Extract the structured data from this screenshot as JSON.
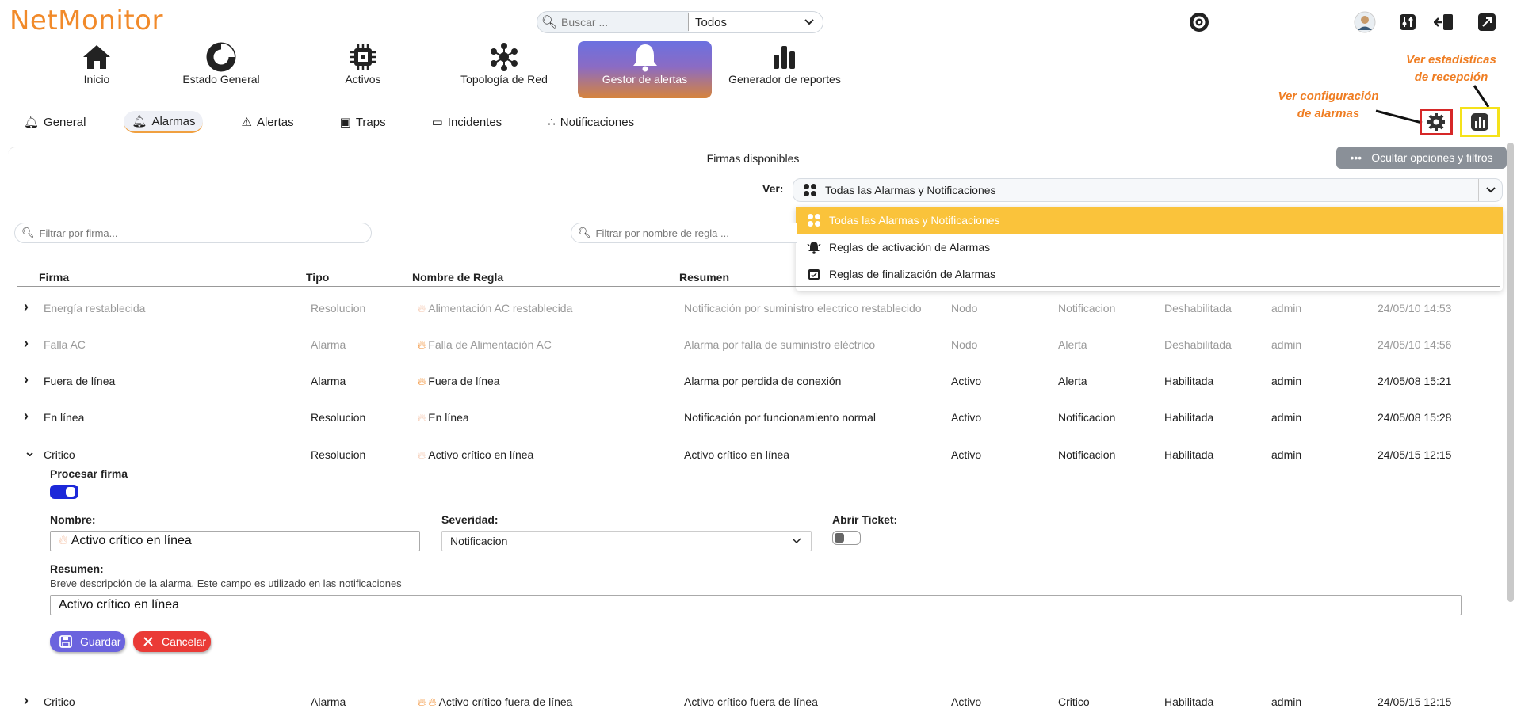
{
  "app": {
    "logo": "NetMonitor"
  },
  "search": {
    "placeholder": "Buscar ...",
    "scope": "Todos"
  },
  "nav": [
    {
      "label": "Inicio",
      "icon": "home-icon"
    },
    {
      "label": "Estado General",
      "icon": "donut-chart-icon"
    },
    {
      "label": "Activos",
      "icon": "chip-icon"
    },
    {
      "label": "Topología de Red",
      "icon": "network-topology-icon"
    },
    {
      "label": "Gestor de alertas",
      "icon": "bell-icon"
    },
    {
      "label": "Generador de reportes",
      "icon": "bar-chart-icon"
    }
  ],
  "tabs": [
    {
      "label": "General",
      "icon": "bell-icon"
    },
    {
      "label": "Alarmas",
      "icon": "bell-icon"
    },
    {
      "label": "Alertas",
      "icon": "warning-icon"
    },
    {
      "label": "Traps",
      "icon": "trap-icon"
    },
    {
      "label": "Incidentes",
      "icon": "ticket-icon"
    },
    {
      "label": "Notificaciones",
      "icon": "share-icon"
    }
  ],
  "annotations": {
    "config": "Ver configuración\nde alarmas",
    "stats": "Ver estadísticas\nde recepción"
  },
  "firmas": {
    "title": "Firmas disponibles",
    "toggle_filters": "Ocultar opciones y filtros"
  },
  "ver": {
    "label": "Ver:",
    "selected": "Todas las Alarmas y Notificaciones",
    "options": [
      "Todas las Alarmas y Notificaciones",
      "Reglas de activación de Alarmas",
      "Reglas de finalización de Alarmas"
    ]
  },
  "filters": {
    "firma_placeholder": "Filtrar por firma...",
    "regla_placeholder": "Filtrar por nombre de regla ..."
  },
  "table": {
    "headers": [
      "Firma",
      "Tipo",
      "Nombre de Regla",
      "Resumen"
    ],
    "rows": [
      {
        "firma": "Energía restablecida",
        "tipo": "Resolucion",
        "regla": "Alimentación AC restablecida",
        "resumen": "Notificación por suministro electrico restablecido",
        "ambito": "Nodo",
        "severidad": "Notificacion",
        "estado": "Deshabilitada",
        "usuario": "admin",
        "fecha": "24/05/10 14:53",
        "dim": true,
        "fire": "light"
      },
      {
        "firma": "Falla AC",
        "tipo": "Alarma",
        "regla": "Falla de Alimentación AC",
        "resumen": "Alarma por falla de suministro eléctrico",
        "ambito": "Nodo",
        "severidad": "Alerta",
        "estado": "Deshabilitada",
        "usuario": "admin",
        "fecha": "24/05/10 14:56",
        "dim": true,
        "fire": "orange"
      },
      {
        "firma": "Fuera de línea",
        "tipo": "Alarma",
        "regla": "Fuera de línea",
        "resumen": "Alarma por perdida de conexión",
        "ambito": "Activo",
        "severidad": "Alerta",
        "estado": "Habilitada",
        "usuario": "admin",
        "fecha": "24/05/08 15:21",
        "dim": false,
        "fire": "orange"
      },
      {
        "firma": "En línea",
        "tipo": "Resolucion",
        "regla": "En línea",
        "resumen": "Notificación por funcionamiento normal",
        "ambito": "Activo",
        "severidad": "Notificacion",
        "estado": "Habilitada",
        "usuario": "admin",
        "fecha": "24/05/08 15:28",
        "dim": false,
        "fire": "light"
      },
      {
        "firma": "Critico",
        "tipo": "Resolucion",
        "regla": "Activo crítico en línea",
        "resumen": "Activo crítico en línea",
        "ambito": "Activo",
        "severidad": "Notificacion",
        "estado": "Habilitada",
        "usuario": "admin",
        "fecha": "24/05/15 12:15",
        "dim": false,
        "fire": "light",
        "expanded": true
      }
    ],
    "last_row": {
      "firma": "Critico",
      "tipo": "Alarma",
      "regla": "Activo crítico fuera de línea",
      "resumen": "Activo crítico fuera de línea",
      "ambito": "Activo",
      "severidad": "Critico",
      "estado": "Habilitada",
      "usuario": "admin",
      "fecha": "24/05/15 12:15"
    }
  },
  "detail": {
    "procesar_label": "Procesar firma",
    "nombre_label": "Nombre:",
    "nombre_value": "Activo crítico en línea",
    "severidad_label": "Severidad:",
    "severidad_value": "Notificacion",
    "ticket_label": "Abrir Ticket:",
    "resumen_label": "Resumen:",
    "resumen_help": "Breve descripción de la alarma. Este campo es utilizado en las notificaciones",
    "resumen_value": "Activo crítico en línea",
    "save": "Guardar",
    "cancel": "Cancelar"
  }
}
